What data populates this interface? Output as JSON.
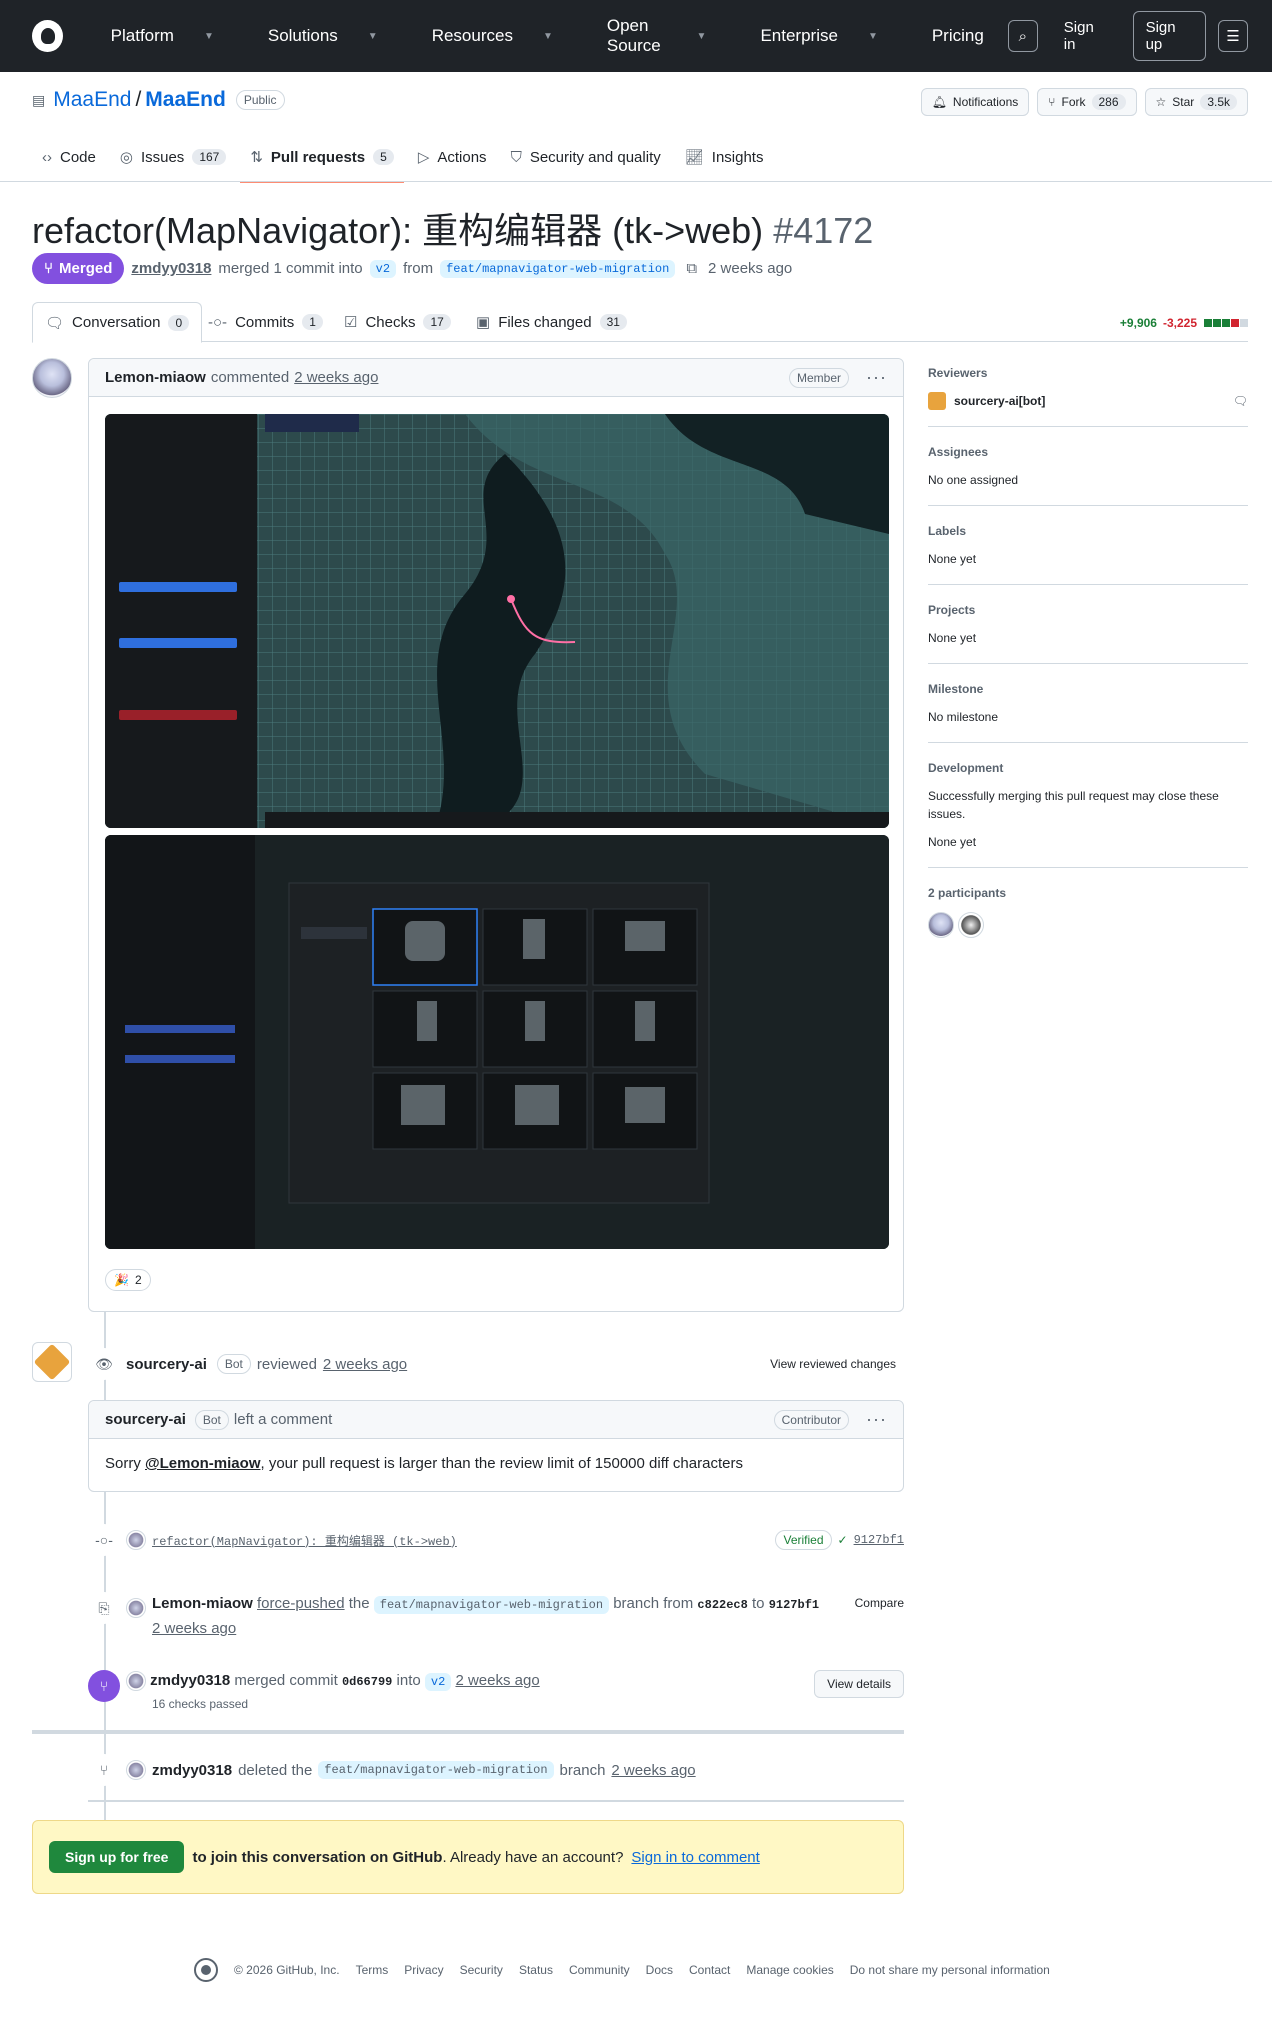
{
  "header": {
    "nav": [
      "Platform",
      "Solutions",
      "Resources",
      "Open Source",
      "Enterprise",
      "Pricing"
    ],
    "sign_in": "Sign in",
    "sign_up": "Sign up"
  },
  "repo": {
    "owner": "MaaEnd",
    "name": "MaaEnd",
    "visibility": "Public",
    "notifications": "Notifications",
    "fork_label": "Fork",
    "fork_count": "286",
    "star_label": "Star",
    "star_count": "3.5k"
  },
  "repo_tabs": [
    {
      "label": "Code",
      "count": ""
    },
    {
      "label": "Issues",
      "count": "167"
    },
    {
      "label": "Pull requests",
      "count": "5"
    },
    {
      "label": "Actions",
      "count": ""
    },
    {
      "label": "Security and quality",
      "count": ""
    },
    {
      "label": "Insights",
      "count": ""
    }
  ],
  "pr": {
    "title": "refactor(MapNavigator): 重构编辑器 (tk->web)",
    "number": "#4172",
    "state": "Merged",
    "author": "zmdyy0318",
    "merge_text": "merged 1 commit into",
    "base": "v2",
    "from": "from",
    "head": "feat/mapnavigator-web-migration",
    "time": "2 weeks ago"
  },
  "pr_tabs": [
    {
      "label": "Conversation",
      "count": "0"
    },
    {
      "label": "Commits",
      "count": "1"
    },
    {
      "label": "Checks",
      "count": "17"
    },
    {
      "label": "Files changed",
      "count": "31"
    }
  ],
  "diffstat": {
    "add": "+9,906",
    "del": "-3,225"
  },
  "comment1": {
    "author": "Lemon-miaow",
    "verb": "commented",
    "time": "2 weeks ago",
    "role": "Member",
    "reaction": "🎉",
    "reaction_count": "2"
  },
  "review": {
    "author": "sourcery-ai",
    "bot": "Bot",
    "verb": "reviewed",
    "time": "2 weeks ago",
    "action": "View reviewed changes"
  },
  "comment2": {
    "author": "sourcery-ai",
    "bot": "Bot",
    "verb": "left a comment",
    "role": "Contributor",
    "body_pre": "Sorry ",
    "mention": "@Lemon-miaow",
    "body_post": ", your pull request is larger than the review limit of 150000 diff characters"
  },
  "commit": {
    "message": "refactor(MapNavigator): 重构编辑器 (tk->web)",
    "verified": "Verified",
    "sha": "9127bf1"
  },
  "force_push": {
    "author": "Lemon-miaow",
    "verb": "force-pushed",
    "the": "the",
    "branch": "feat/mapnavigator-web-migration",
    "from": "branch from",
    "old": "c822ec8",
    "to": "to",
    "new": "9127bf1",
    "time": "2 weeks ago",
    "action": "Compare"
  },
  "merge_event": {
    "author": "zmdyy0318",
    "verb": "merged commit",
    "sha": "0d66799",
    "into": "into",
    "base": "v2",
    "time": "2 weeks ago",
    "checks": "16 checks passed",
    "action": "View details"
  },
  "delete_event": {
    "author": "zmdyy0318",
    "verb": "deleted the",
    "branch": "feat/mapnavigator-web-migration",
    "suffix": "branch",
    "time": "2 weeks ago"
  },
  "sidebar": {
    "reviewers_h": "Reviewers",
    "reviewer": "sourcery-ai[bot]",
    "assignees_h": "Assignees",
    "assignees": "No one assigned",
    "labels_h": "Labels",
    "labels": "None yet",
    "projects_h": "Projects",
    "projects": "None yet",
    "milestone_h": "Milestone",
    "milestone": "No milestone",
    "development_h": "Development",
    "development": "Successfully merging this pull request may close these issues.",
    "development2": "None yet",
    "participants_h": "2 participants"
  },
  "banner": {
    "button": "Sign up for free",
    "text1": "to join this conversation on GitHub",
    "text2": ". Already have an account?",
    "link": "Sign in to comment"
  },
  "footer": {
    "copyright": "© 2026 GitHub, Inc.",
    "links": [
      "Terms",
      "Privacy",
      "Security",
      "Status",
      "Community",
      "Docs",
      "Contact",
      "Manage cookies",
      "Do not share my personal information"
    ]
  }
}
